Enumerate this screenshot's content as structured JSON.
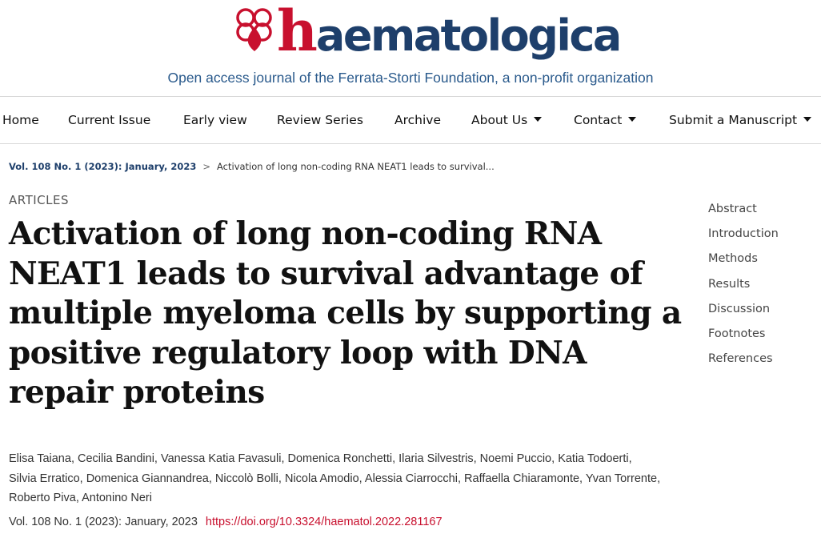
{
  "brand": {
    "logo_h": "h",
    "logo_rest": "aematologica",
    "tagline": "Open access journal of the Ferrata-Storti Foundation, a non-profit organization",
    "primary_color": "#c8102e",
    "secondary_color": "#1e3f6b"
  },
  "nav": {
    "items": [
      {
        "label": "Home",
        "dropdown": false
      },
      {
        "label": "Current Issue",
        "dropdown": false
      },
      {
        "label": "Early view",
        "dropdown": false
      },
      {
        "label": "Review Series",
        "dropdown": false
      },
      {
        "label": "Archive",
        "dropdown": false
      },
      {
        "label": "About Us",
        "dropdown": true
      },
      {
        "label": "Contact",
        "dropdown": true
      },
      {
        "label": "Submit a Manuscript",
        "dropdown": true
      }
    ]
  },
  "breadcrumb": {
    "issue": "Vol. 108 No. 1 (2023): January, 2023",
    "separator": ">",
    "current": "Activation of long non-coding RNA NEAT1 leads to survival..."
  },
  "article": {
    "section": "ARTICLES",
    "title": "Activation of long non-coding RNA NEAT1 leads to survival advantage of multiple myeloma cells by supporting a positive regulatory loop with DNA repair proteins",
    "authors": [
      "Elisa Taiana",
      "Cecilia Bandini",
      "Vanessa Katia Favasuli",
      "Domenica Ronchetti",
      "Ilaria Silvestris",
      "Noemi Puccio",
      "Katia Todoerti",
      "Silvia Erratico",
      "Domenica Giannandrea",
      "Niccolò Bolli",
      "Nicola Amodio",
      "Alessia Ciarrocchi",
      "Raffaella Chiaramonte",
      "Yvan Torrente",
      "Roberto Piva",
      "Antonino Neri"
    ],
    "issue": "Vol. 108 No. 1 (2023): January, 2023",
    "doi": "https://doi.org/10.3324/haematol.2022.281167"
  },
  "toc": {
    "items": [
      "Abstract",
      "Introduction",
      "Methods",
      "Results",
      "Discussion",
      "Footnotes",
      "References"
    ]
  }
}
